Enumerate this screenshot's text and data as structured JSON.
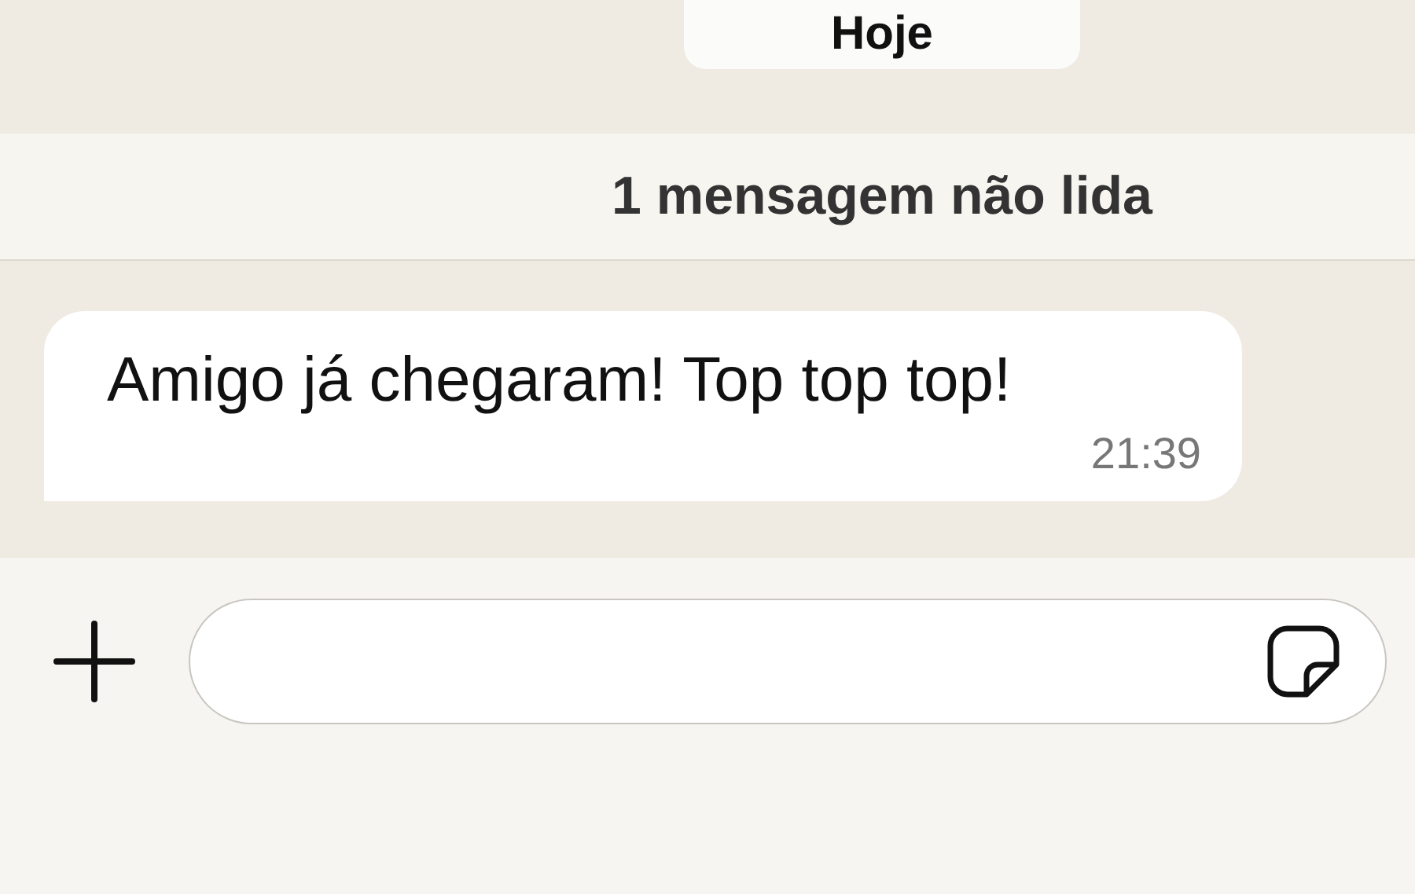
{
  "date_label": "Hoje",
  "unread_banner": "1 mensagem não lida",
  "messages": [
    {
      "text": "Amigo já chegaram! Top top top!",
      "time": "21:39"
    }
  ]
}
